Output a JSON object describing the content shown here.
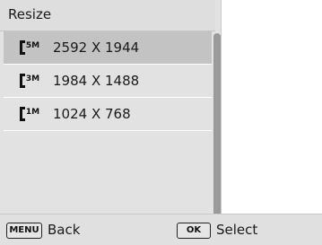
{
  "header": {
    "title": "Resize"
  },
  "items": [
    {
      "label": "2592 X 1944",
      "icon": "5m-size-icon",
      "badge": "5M",
      "selected": true
    },
    {
      "label": "1984 X 1488",
      "icon": "3m-size-icon",
      "badge": "3M",
      "selected": false
    },
    {
      "label": "1024 X 768",
      "icon": "1m-size-icon",
      "badge": "1M",
      "selected": false
    }
  ],
  "footer": {
    "back_key": "MENU",
    "back_label": "Back",
    "select_key": "OK",
    "select_label": "Select"
  },
  "colors": {
    "panel": "#e2e2e2",
    "selected_row": "#c3c3c3",
    "scrollbar": "#9a9a9a"
  }
}
